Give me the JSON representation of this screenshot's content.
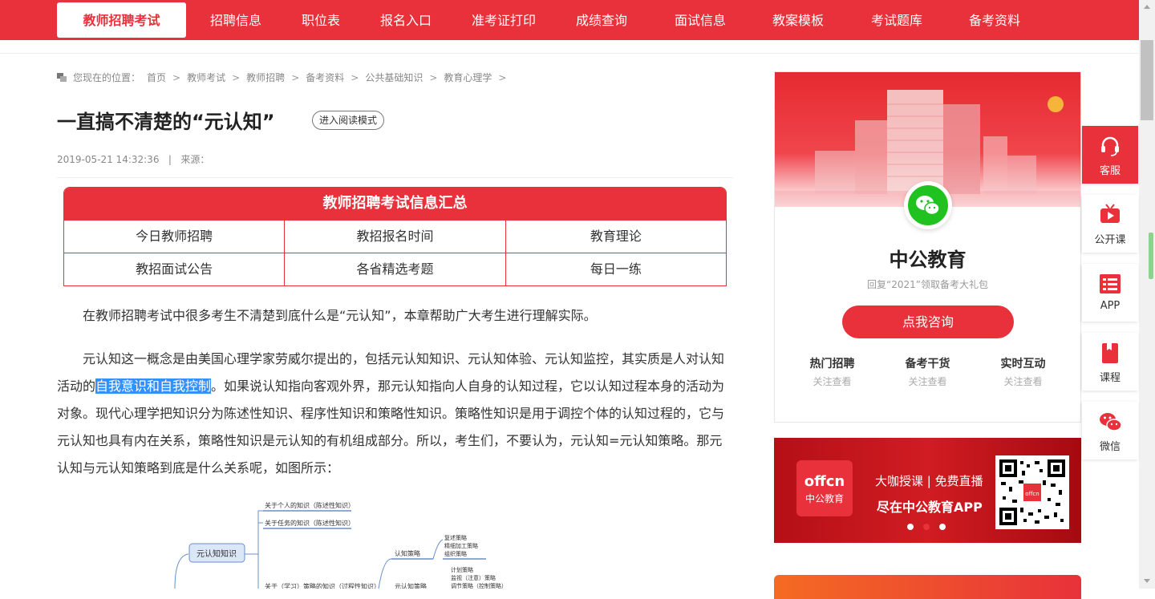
{
  "nav": {
    "active": "教师招聘考试",
    "items": [
      "招聘信息",
      "职位表",
      "报名入口",
      "准考证打印",
      "成绩查询",
      "面试信息",
      "教案模板",
      "考试题库",
      "备考资料"
    ]
  },
  "breadcrumb": {
    "prefix": "您现在的位置：",
    "items": [
      "首页",
      "教师考试",
      "教师招聘",
      "备考资料",
      "公共基础知识",
      "教育心理学"
    ],
    "separator": ">"
  },
  "article": {
    "title": "一直搞不清楚的“元认知”",
    "read_mode": "进入阅读模式",
    "date": "2019-05-21 14:32:36",
    "source_label": "来源：",
    "meta_sep": "|",
    "p1": "在教师招聘考试中很多考生不清楚到底什么是“元认知”，本章帮助广大考生进行理解实际。",
    "p2_a": "元认知这一概念是由美国心理学家劳威尔提出的，包括元认知知识、元认知体验、元认知监控，其实质是人对认知活动的",
    "p2_highlight": "自我意识和自我控制",
    "p2_b": "。如果说认知指向客观外界，那元认知指向人自身的认知过程，它以认知过程本身的活动为对象。现代心理学把知识分为陈述性知识、程序性知识和策略性知识。策略性知识是用于调控个体的认知过程的，它与元认知也具有内在关系，策略性知识是元认知的有机组成部分。所以，考生们，不要认为，元认知=元认知策略。那元认知与元认知策略到底是什么关系呢，如图所示："
  },
  "info_table": {
    "title": "教师招聘考试信息汇总",
    "rows": [
      [
        "今日教师招聘",
        "教招报名时间",
        "教育理论"
      ],
      [
        "教招面试公告",
        "各省精选考题",
        "每日一练"
      ]
    ]
  },
  "mindmap": {
    "root": "元认知知识",
    "branches": [
      "关于个人的知识（陈述性知识）",
      "关于任务的知识（陈述性知识）",
      "关于（学习）策略的知识（过程性知识）"
    ],
    "strategy1": "认知策略",
    "strategy1_items": [
      "复述策略",
      "精细加工策略",
      "组织策略"
    ],
    "strategy2": "元认知策略",
    "strategy2_items": [
      "计划策略",
      "监视（注意）策略",
      "调节策略（控制策略）"
    ]
  },
  "sidebar_card": {
    "name": "中公教育",
    "subtitle": "回复“2021”领取备考大礼包",
    "consult": "点我咨询",
    "links": [
      {
        "title": "热门招聘",
        "sub": "关注查看"
      },
      {
        "title": "备考干货",
        "sub": "关注查看"
      },
      {
        "title": "实时互动",
        "sub": "关注查看"
      }
    ]
  },
  "ad": {
    "logo_text": "offcn",
    "logo_sub": "中公教育",
    "line1": "大咖授课 | 免费直播",
    "line2": "尽在中公教育APP"
  },
  "float_bar": {
    "items": [
      "客服",
      "公开课",
      "APP",
      "课程",
      "微信"
    ]
  },
  "colors": {
    "brand": "#e8313a",
    "wechat": "#1fc21f",
    "highlight": "#3390ff"
  }
}
